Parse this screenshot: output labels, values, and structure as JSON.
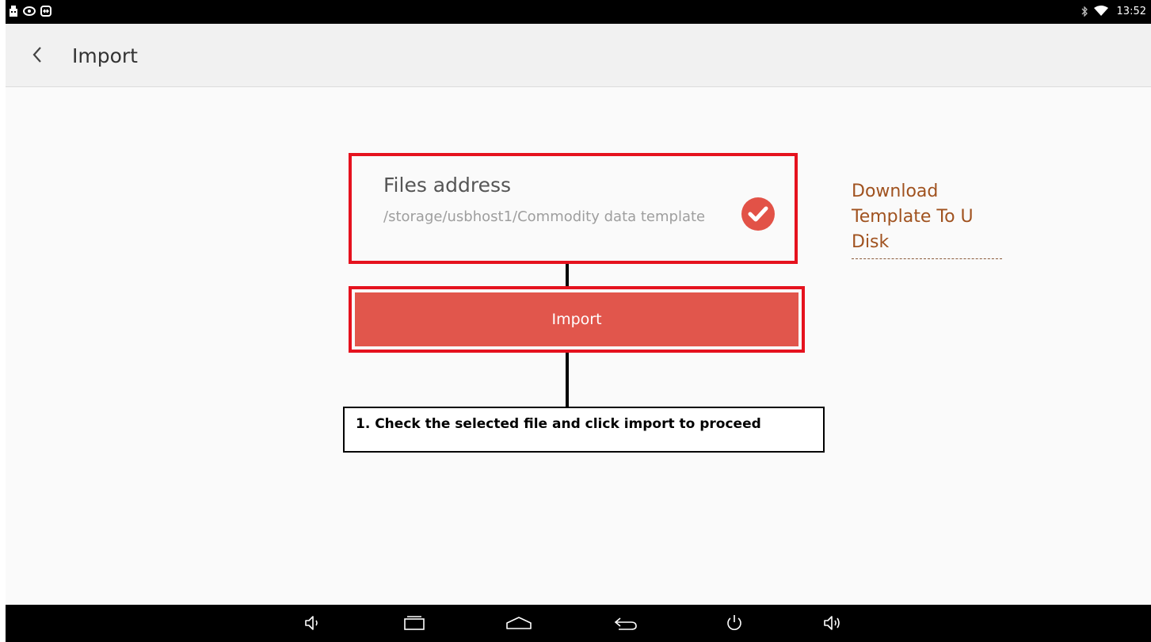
{
  "status_bar": {
    "time": "13:52",
    "left_icons": [
      "usb-icon",
      "eye-icon",
      "teamviewer-icon"
    ],
    "right_icons": [
      "bluetooth-icon",
      "wifi-icon"
    ]
  },
  "header": {
    "title": "Import",
    "back_icon": "chevron-left-icon"
  },
  "file_selector": {
    "label": "Files address",
    "path": "/storage/usbhost1/Commodity data template",
    "selected": true,
    "check_color": "#e25247"
  },
  "import_button": {
    "label": "Import",
    "color": "#e1564c"
  },
  "download_link": {
    "label": "Download Template To U Disk",
    "color": "#a0521f"
  },
  "annotation": {
    "text": "1. Check the selected file and click import to proceed",
    "highlight_color": "#e5121e"
  },
  "nav_bar": {
    "buttons": [
      "volume-down-icon",
      "recent-apps-icon",
      "home-icon",
      "back-icon",
      "power-icon",
      "volume-up-icon"
    ]
  }
}
